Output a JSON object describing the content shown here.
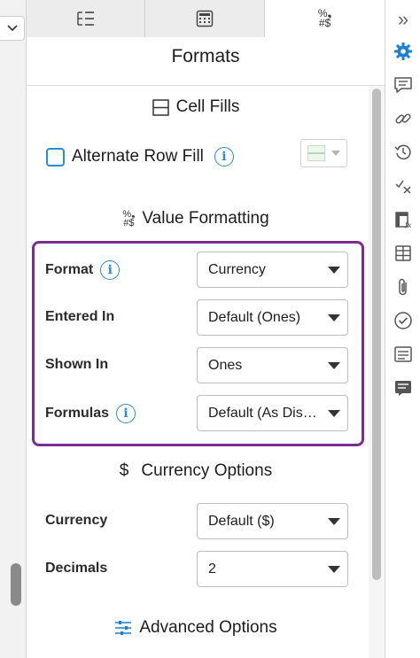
{
  "tabs": [
    {
      "icon": "outline-list-icon"
    },
    {
      "icon": "calculator-icon"
    },
    {
      "icon": "number-format-icon",
      "glyph_top": "%❟",
      "glyph_bottom": "#$"
    }
  ],
  "title": "Formats",
  "cell_fills": {
    "heading": "Cell Fills",
    "alternate_row_fill_label": "Alternate Row Fill",
    "alternate_row_fill_checked": false
  },
  "value_formatting": {
    "heading": "Value Formatting",
    "format_label": "Format",
    "format_value": "Currency",
    "entered_in_label": "Entered In",
    "entered_in_value": "Default (Ones)",
    "shown_in_label": "Shown In",
    "shown_in_value": "Ones",
    "formulas_label": "Formulas",
    "formulas_value": "Default (As Disp…"
  },
  "currency_options": {
    "heading_symbol": "$",
    "heading": "Currency Options",
    "currency_label": "Currency",
    "currency_value": "Default ($)",
    "decimals_label": "Decimals",
    "decimals_value": "2"
  },
  "advanced": {
    "heading": "Advanced Options"
  },
  "gutter": {
    "dropdown_glyph": "⌄"
  },
  "sidebar": {
    "collapse_glyph": "»",
    "icons": [
      "gear-icon",
      "comment-icon",
      "link-icon",
      "history-icon",
      "check-off-icon",
      "function-icon",
      "table-icon",
      "attachment-icon",
      "checkmark-circle-icon",
      "list-card-icon",
      "note-icon"
    ]
  },
  "colors": {
    "accent": "#2a8bd8",
    "highlight": "#7b2d8e",
    "active_icon": "#1a7fd6"
  }
}
